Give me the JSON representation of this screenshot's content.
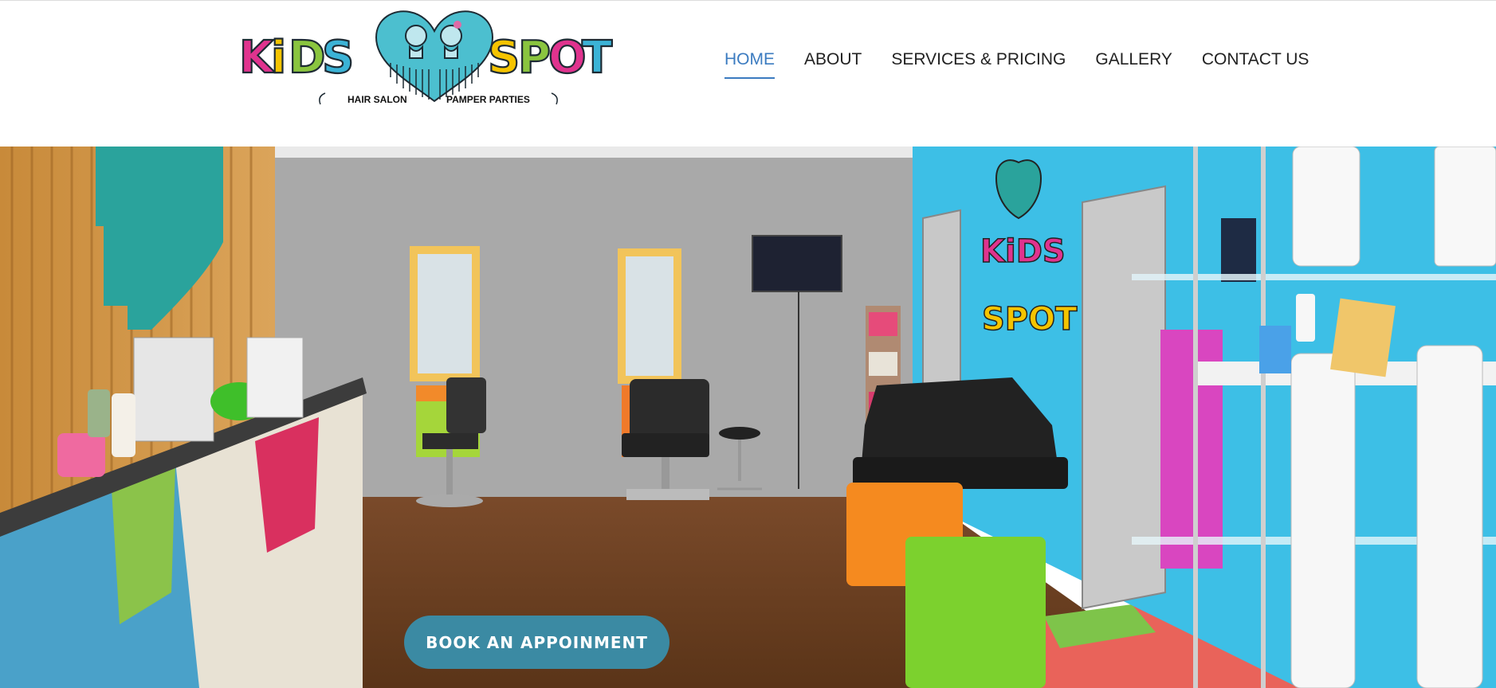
{
  "brand": {
    "logo_word_left": "KiDS",
    "logo_word_right": "SPOT",
    "tagline_left": "HAIR SALON",
    "tagline_right": "PAMPER PARTIES",
    "logo_letter_colors": [
      "#e0338e",
      "#f5c400",
      "#8ac53f",
      "#3bb3d6",
      "#8ac53f",
      "#f5c400",
      "#e0338e",
      "#3bb3d6"
    ],
    "heart_color": "#4cbfcf"
  },
  "nav": {
    "items": [
      {
        "label": "HOME",
        "active": true
      },
      {
        "label": "ABOUT",
        "active": false
      },
      {
        "label": "SERVICES & PRICING",
        "active": false
      },
      {
        "label": "GALLERY",
        "active": false
      },
      {
        "label": "CONTACT US",
        "active": false
      }
    ],
    "active_color": "#3b7bc0"
  },
  "hero": {
    "sign_word_top": "KiDS",
    "sign_word_bottom": "SPOT",
    "book_button_label": "BOOK AN APPOINMENT",
    "button_color": "#3b8aa3"
  }
}
